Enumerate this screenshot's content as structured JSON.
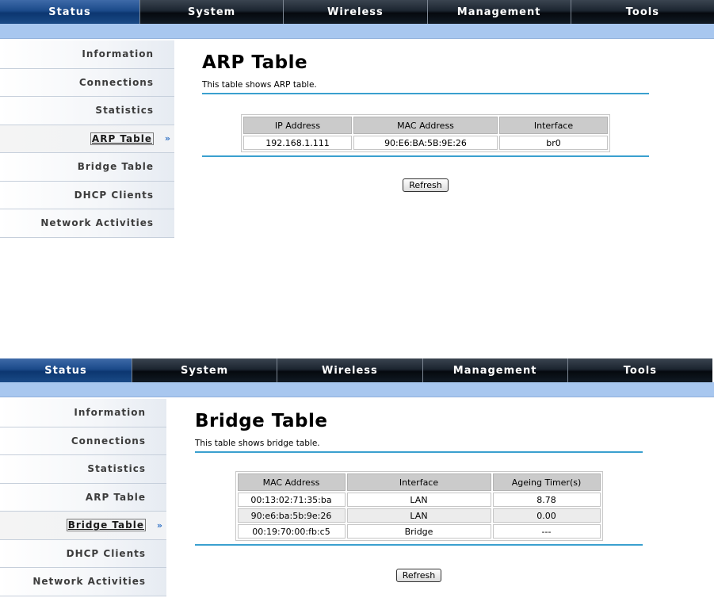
{
  "nav": {
    "tabs": [
      {
        "label": "Status"
      },
      {
        "label": "System"
      },
      {
        "label": "Wireless"
      },
      {
        "label": "Management"
      },
      {
        "label": "Tools"
      }
    ]
  },
  "sidebar": {
    "items": [
      {
        "label": "Information"
      },
      {
        "label": "Connections"
      },
      {
        "label": "Statistics"
      },
      {
        "label": "ARP Table"
      },
      {
        "label": "Bridge Table"
      },
      {
        "label": "DHCP Clients"
      },
      {
        "label": "Network Activities"
      }
    ],
    "arrow_glyph": "»"
  },
  "arp": {
    "title": "ARP Table",
    "description": "This table shows ARP table.",
    "headers": [
      "IP Address",
      "MAC Address",
      "Interface"
    ],
    "rows": [
      [
        "192.168.1.111",
        "90:E6:BA:5B:9E:26",
        "br0"
      ]
    ],
    "refresh_label": "Refresh"
  },
  "bridge": {
    "title": "Bridge Table",
    "description": "This table shows bridge table.",
    "headers": [
      "MAC Address",
      "Interface",
      "Ageing Timer(s)"
    ],
    "rows": [
      [
        "00:13:02:71:35:ba",
        "LAN",
        "8.78"
      ],
      [
        "90:e6:ba:5b:9e:26",
        "LAN",
        "0.00"
      ],
      [
        "00:19:70:00:fb:c5",
        "Bridge",
        "---"
      ]
    ],
    "refresh_label": "Refresh"
  },
  "colors": {
    "nav_active": "#1b4a8a",
    "nav_bg": "#111a24",
    "subbar": "#a8c7ef",
    "rule": "#3aa0cf"
  }
}
